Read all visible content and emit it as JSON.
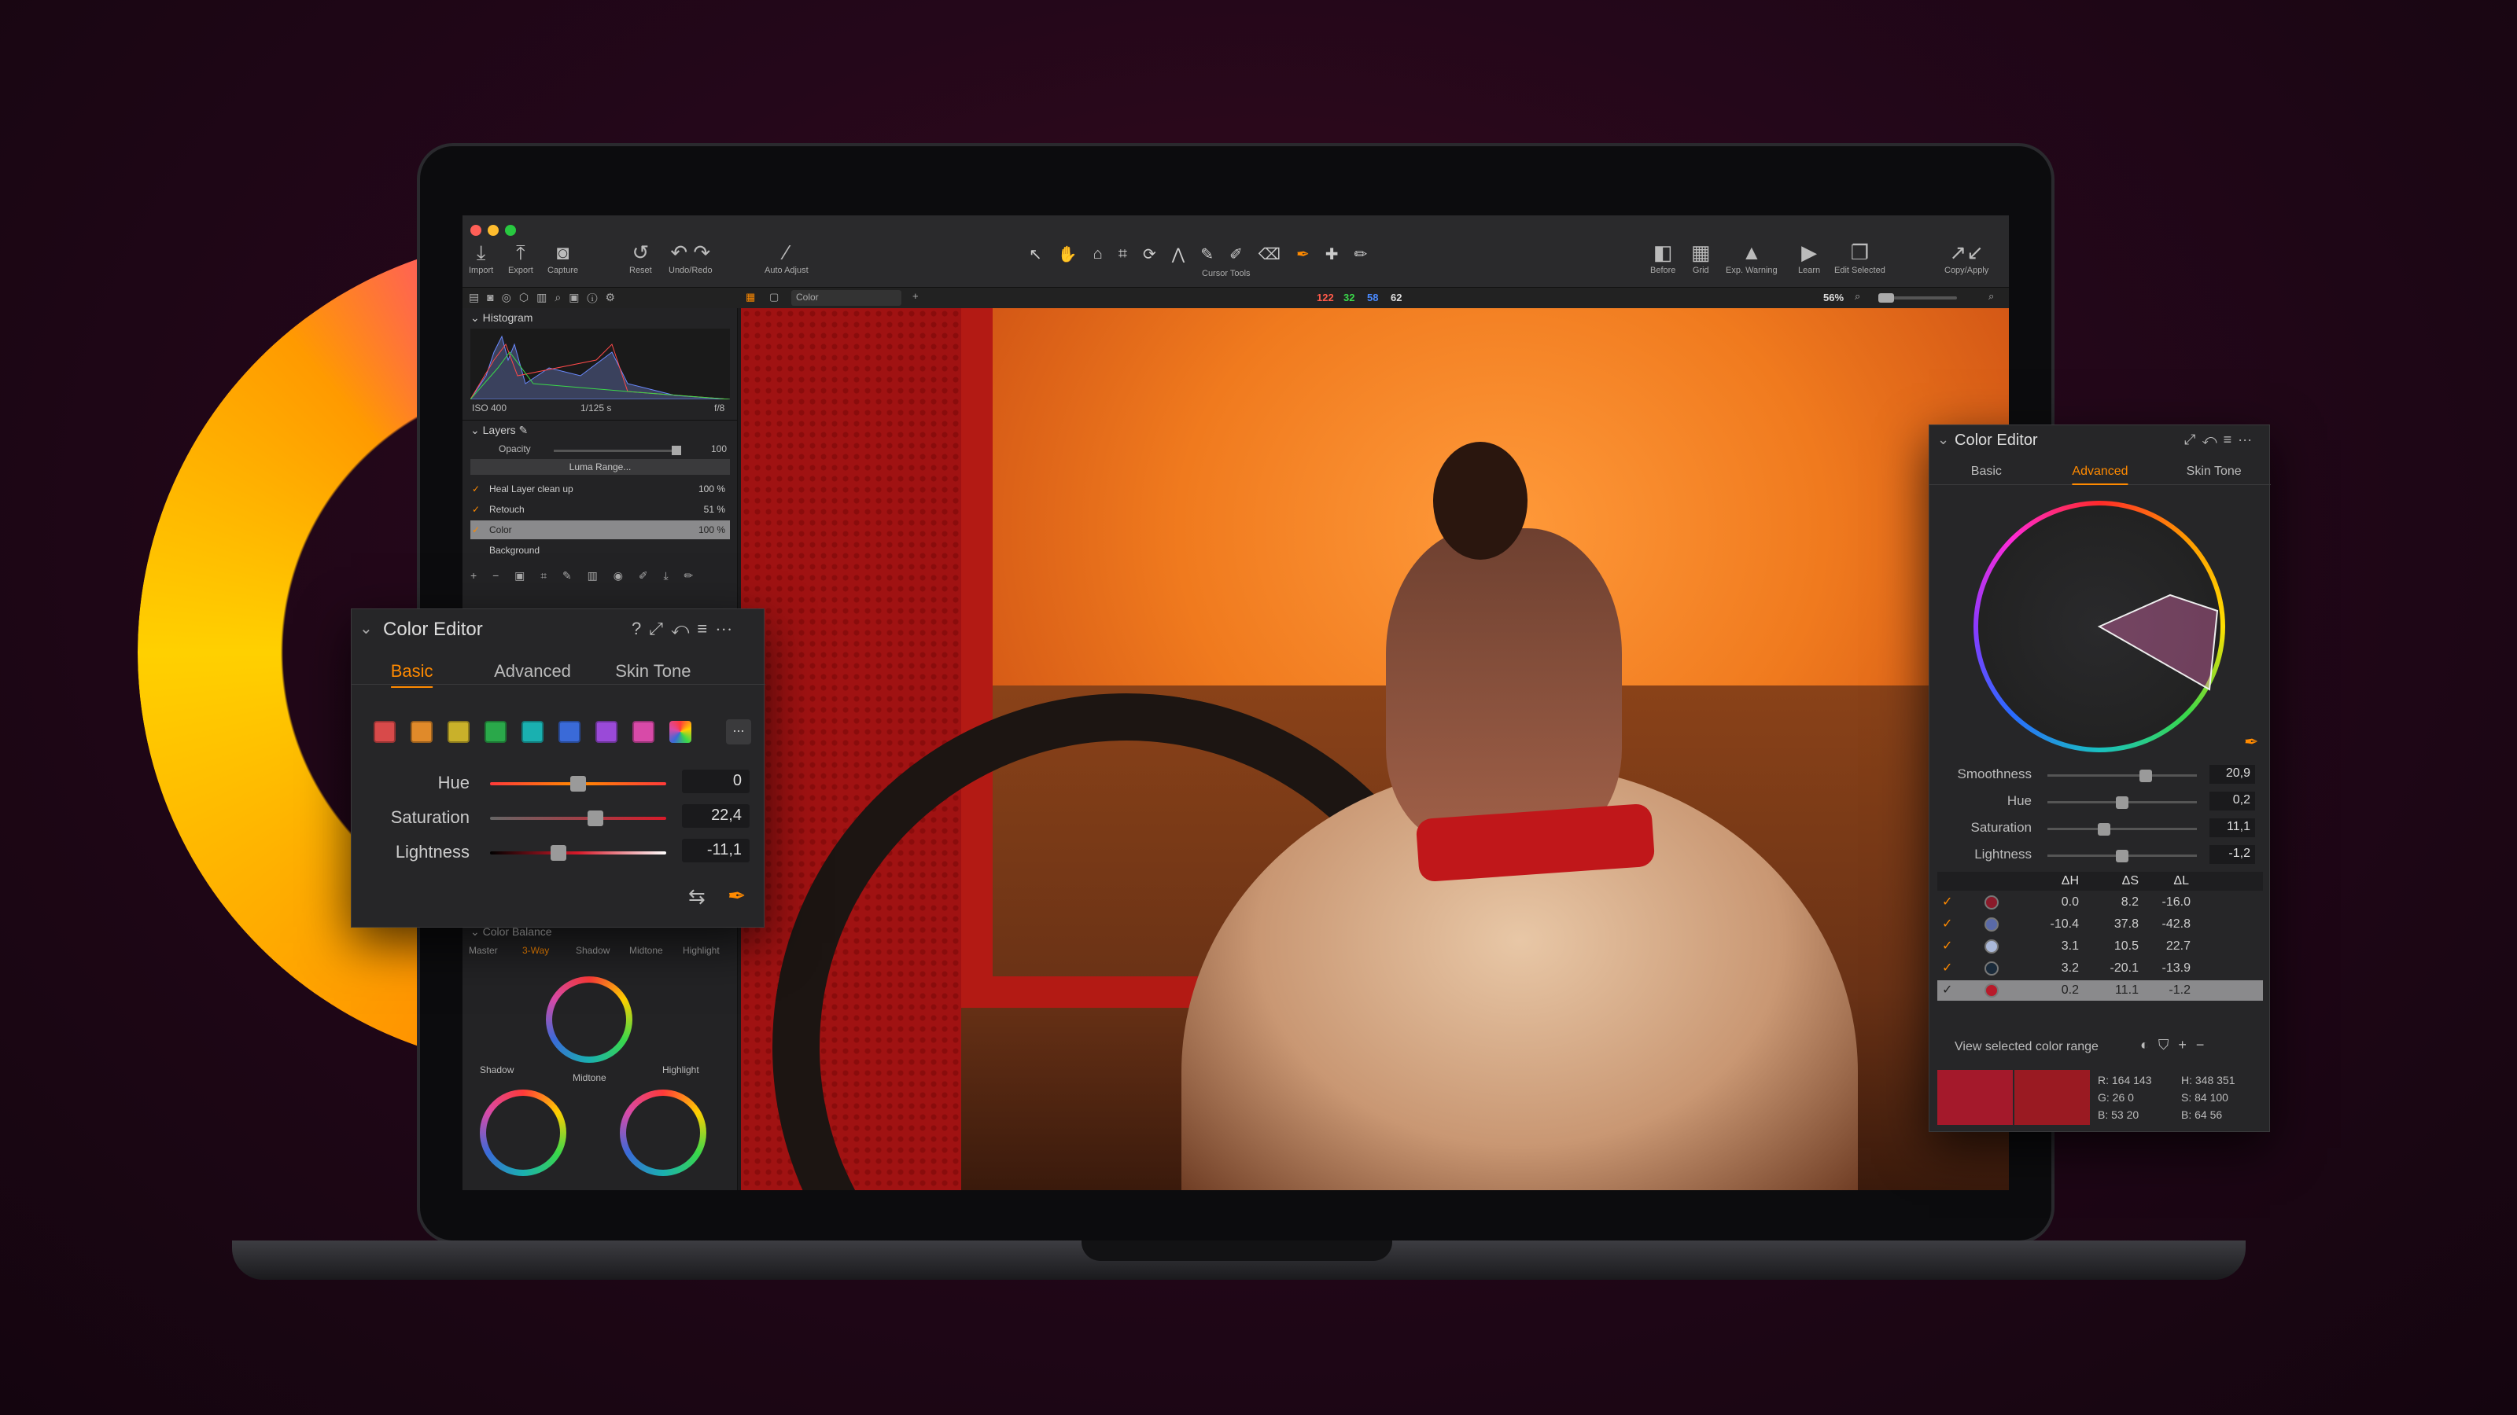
{
  "toolbar": {
    "buttons_left": [
      "Import",
      "Export",
      "Capture"
    ],
    "reset": "Reset",
    "undo_redo": "Undo/Redo",
    "auto_adjust": "Auto Adjust",
    "cursor_tools": "Cursor Tools",
    "buttons_right": [
      "Before",
      "Grid",
      "Exp. Warning",
      "Learn",
      "Edit Selected",
      "Copy/Apply"
    ]
  },
  "viewer_bar": {
    "variant_select": "Color",
    "rgb_readout": {
      "r": "122",
      "g": "32",
      "b": "58",
      "l": "62"
    },
    "zoom": "56%"
  },
  "histogram": {
    "title": "Histogram",
    "iso": "ISO 400",
    "shutter": "1/125 s",
    "aperture": "f/8"
  },
  "layers": {
    "title": "Layers",
    "opacity_label": "Opacity",
    "opacity_value": "100",
    "luma_range": "Luma Range...",
    "items": [
      {
        "name": "Heal Layer clean up",
        "value": "100 %",
        "checked": true
      },
      {
        "name": "Retouch",
        "value": "51 %",
        "checked": true
      },
      {
        "name": "Color",
        "value": "100 %",
        "checked": true,
        "selected": true
      },
      {
        "name": "Background",
        "value": "",
        "checked": false
      }
    ]
  },
  "color_balance": {
    "title": "Color Balance",
    "tabs": [
      "Master",
      "3-Way",
      "Shadow",
      "Midtone",
      "Highlight"
    ],
    "active_tab": "3-Way",
    "wheel_labels": [
      "Shadow",
      "Midtone",
      "Highlight"
    ]
  },
  "color_editor_left": {
    "title": "Color Editor",
    "tabs": [
      "Basic",
      "Advanced",
      "Skin Tone"
    ],
    "active_tab": "Basic",
    "swatches": [
      "#d84a4a",
      "#e08a2a",
      "#c9b12a",
      "#2aa84a",
      "#1ab0b0",
      "#3a6ad8",
      "#9a4ad8",
      "#d84aa8"
    ],
    "more": "...",
    "sliders": [
      {
        "label": "Hue",
        "value": "0",
        "pos": 0.5
      },
      {
        "label": "Saturation",
        "value": "22,4",
        "pos": 0.6
      },
      {
        "label": "Lightness",
        "value": "-11,1",
        "pos": 0.39
      }
    ]
  },
  "color_editor_right": {
    "title": "Color Editor",
    "tabs": [
      "Basic",
      "Advanced",
      "Skin Tone"
    ],
    "active_tab": "Advanced",
    "sliders": [
      {
        "label": "Smoothness",
        "value": "20,9",
        "pos": 0.66
      },
      {
        "label": "Hue",
        "value": "0,2",
        "pos": 0.5
      },
      {
        "label": "Saturation",
        "value": "11,1",
        "pos": 0.38
      },
      {
        "label": "Lightness",
        "value": "-1,2",
        "pos": 0.5
      }
    ],
    "table_headers": [
      "ΔH",
      "ΔS",
      "ΔL"
    ],
    "rows": [
      {
        "color": "#8a1a2a",
        "dh": "0.0",
        "ds": "8.2",
        "dl": "-16.0",
        "selected": false
      },
      {
        "color": "#5a6aa8",
        "dh": "-10.4",
        "ds": "37.8",
        "dl": "-42.8",
        "selected": false
      },
      {
        "color": "#aab8d8",
        "dh": "3.1",
        "ds": "10.5",
        "dl": "22.7",
        "selected": false
      },
      {
        "color": "#1a2a3a",
        "dh": "3.2",
        "ds": "-20.1",
        "dl": "-13.9",
        "selected": false
      },
      {
        "color": "#b81a2a",
        "dh": "0.2",
        "ds": "11.1",
        "dl": "-1.2",
        "selected": true
      }
    ],
    "view_range_label": "View selected color range",
    "swatch_before": "#a4192b",
    "swatch_after": "#9a1a22",
    "readout": {
      "r": "R: 164  143",
      "g": "G: 26   0",
      "b": "B: 53  20",
      "h": "H: 348  351",
      "s": "S: 84  100",
      "bb": "B: 64  56"
    }
  }
}
